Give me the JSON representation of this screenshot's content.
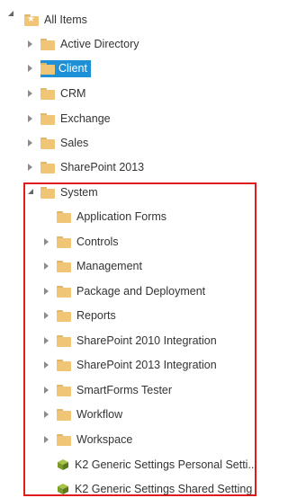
{
  "tree": {
    "root": {
      "label": "All Items",
      "icon": "star-folder-icon"
    },
    "items": [
      {
        "label": "Active Directory",
        "icon": "folder-icon",
        "state": "collapsed"
      },
      {
        "label": "Client",
        "icon": "folder-icon",
        "state": "collapsed",
        "selected": true
      },
      {
        "label": "CRM",
        "icon": "folder-icon",
        "state": "collapsed"
      },
      {
        "label": "Exchange",
        "icon": "folder-icon",
        "state": "collapsed"
      },
      {
        "label": "Sales",
        "icon": "folder-icon",
        "state": "collapsed"
      },
      {
        "label": "SharePoint 2013",
        "icon": "folder-icon",
        "state": "collapsed"
      },
      {
        "label": "System",
        "icon": "folder-icon",
        "state": "expanded"
      }
    ],
    "system_children": [
      {
        "label": "Application Forms",
        "icon": "folder-icon",
        "state": "leaf"
      },
      {
        "label": "Controls",
        "icon": "folder-icon",
        "state": "collapsed"
      },
      {
        "label": "Management",
        "icon": "folder-icon",
        "state": "collapsed"
      },
      {
        "label": "Package and Deployment",
        "icon": "folder-icon",
        "state": "collapsed"
      },
      {
        "label": "Reports",
        "icon": "folder-icon",
        "state": "collapsed"
      },
      {
        "label": "SharePoint 2010 Integration",
        "icon": "folder-icon",
        "state": "collapsed"
      },
      {
        "label": "SharePoint 2013 Integration",
        "icon": "folder-icon",
        "state": "collapsed"
      },
      {
        "label": "SmartForms Tester",
        "icon": "folder-icon",
        "state": "collapsed"
      },
      {
        "label": "Workflow",
        "icon": "folder-icon",
        "state": "collapsed"
      },
      {
        "label": "Workspace",
        "icon": "folder-icon",
        "state": "collapsed"
      },
      {
        "label": "K2 Generic Settings Personal Setti...",
        "icon": "smartobject-cube-icon",
        "state": "leaf"
      },
      {
        "label": "K2 Generic Settings Shared Setting",
        "icon": "smartobject-cube-icon",
        "state": "leaf"
      }
    ]
  },
  "colors": {
    "folder": "#f0c676",
    "selected": "#1e90d8",
    "highlight_border": "#e01b1b",
    "cube": "#7a9a2a"
  }
}
